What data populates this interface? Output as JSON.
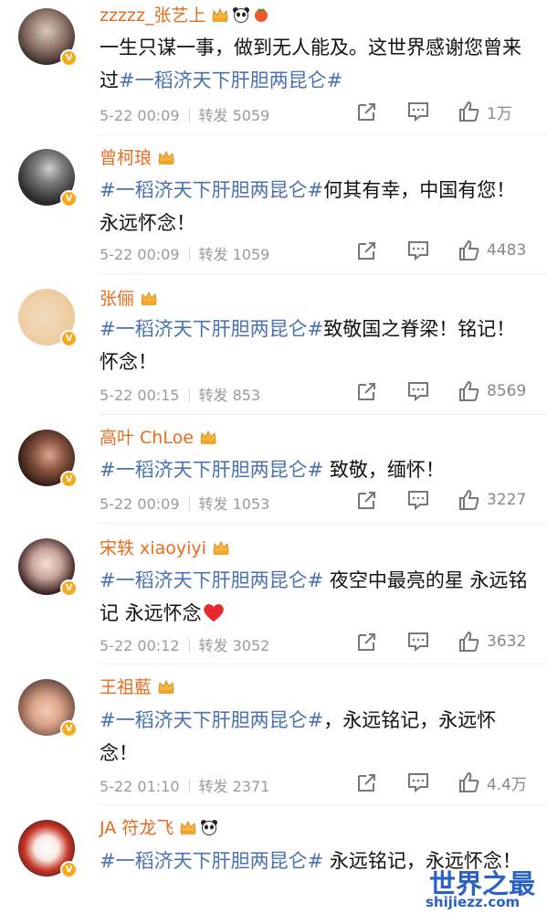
{
  "posts": [
    {
      "name": "zzzzz_张艺上",
      "badges": [
        "crown",
        "panda",
        "gift"
      ],
      "tag": "",
      "text_before": "一生只谋一事，做到无人能及。这世界感谢您曾来过",
      "hashtag": "#一稻济天下肝胆两昆仑#",
      "text_after": "",
      "date": "5-22 00:09",
      "repost": "转发 5059",
      "likes": "1万"
    },
    {
      "name": "曾柯琅",
      "badges": [
        "crown"
      ],
      "text_before": "",
      "hashtag": "#一稻济天下肝胆两昆仑#",
      "text_after": "何其有幸，中国有您！永远怀念！",
      "date": "5-22 00:09",
      "repost": "转发 1059",
      "likes": "4483"
    },
    {
      "name": "张俪",
      "badges": [
        "crown"
      ],
      "text_before": "",
      "hashtag": "#一稻济天下肝胆两昆仑#",
      "text_after": "致敬国之脊梁！铭记！怀念！",
      "date": "5-22 00:15",
      "repost": "转发 853",
      "likes": "8569"
    },
    {
      "name": "高叶 ChLoe",
      "badges": [
        "crown"
      ],
      "text_before": "",
      "hashtag": "#一稻济天下肝胆两昆仑#",
      "text_after": " 致敬，缅怀！",
      "date": "5-22 00:09",
      "repost": "转发 1053",
      "likes": "3227"
    },
    {
      "name": "宋轶 xiaoyiyi",
      "badges": [
        "crown"
      ],
      "text_before": "",
      "hashtag": "#一稻济天下肝胆两昆仑#",
      "text_after": " 夜空中最亮的星 永远铭记 永远怀念",
      "date": "5-22 00:12",
      "repost": "转发 3052",
      "likes": "3632"
    },
    {
      "name": "王祖藍",
      "badges": [
        "crown"
      ],
      "text_before": "",
      "hashtag": "#一稻济天下肝胆两昆仑#",
      "text_after": "，永远铭记，永远怀念！",
      "date": "5-22 01:10",
      "repost": "转发 2371",
      "likes": "4.4万"
    },
    {
      "name": "JA 符龙飞",
      "badges": [
        "crown",
        "panda"
      ],
      "text_before": "",
      "hashtag": "#一稻济天下肝胆两昆仑#",
      "text_after": " 永远铭记，永远怀念！",
      "date": "",
      "repost": "",
      "likes": ""
    }
  ],
  "watermark": {
    "title": "世界之最",
    "url": "shijiezz.com"
  },
  "icons": {
    "share": "share-icon",
    "comment": "comment-icon",
    "like": "thumbs-up-icon",
    "verified": "verified-badge-icon"
  },
  "colors": {
    "name": "#e86c1e",
    "hashtag": "#4a72b2",
    "meta": "#9a9a9a",
    "verified": "#f7a91c"
  }
}
